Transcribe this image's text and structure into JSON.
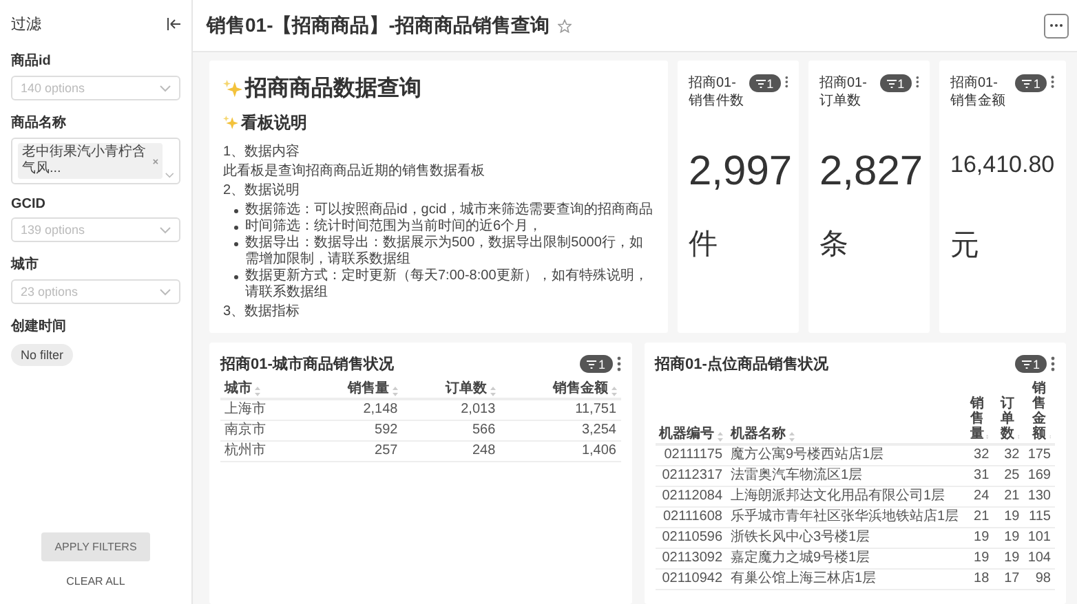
{
  "sidebar": {
    "title": "过滤",
    "filters": [
      {
        "kind": "select",
        "label": "商品id",
        "placeholder": "140 options"
      },
      {
        "kind": "multi",
        "label": "商品名称",
        "tags": [
          "老中街果汽小青柠含气风..."
        ]
      },
      {
        "kind": "select",
        "label": "GCID",
        "placeholder": "139 options"
      },
      {
        "kind": "select",
        "label": "城市",
        "placeholder": "23 options"
      },
      {
        "kind": "chip",
        "label": "创建时间",
        "value": "No filter"
      }
    ],
    "apply_button": "APPLY FILTERS",
    "clear_button": "CLEAR ALL"
  },
  "header": {
    "title": "销售01-【招商商品】-招商商品销售查询",
    "starred": false
  },
  "markdown": {
    "heading": "招商商品数据查询",
    "subheading": "看板说明",
    "blocks": [
      {
        "kind": "para",
        "text": "1、数据内容"
      },
      {
        "kind": "para",
        "text": "此看板是查询招商商品近期的销售数据看板"
      },
      {
        "kind": "para",
        "text": "2、数据说明"
      },
      {
        "kind": "list",
        "items": [
          "数据筛选：可以按照商品id，gcid，城市来筛选需要查询的招商商品",
          "时间筛选：统计时间范围为当前时间的近6个月，",
          "数据导出：数据导出：数据展示为500，数据导出限制5000行，如需增加限制，请联系数据组",
          "数据更新方式：定时更新（每天7:00-8:00更新），如有特殊说明，请联系数据组"
        ]
      },
      {
        "kind": "para",
        "text": "3、数据指标"
      }
    ]
  },
  "kpis": [
    {
      "title": "招商01-销售件数",
      "filter_count": "1",
      "value": "2,997",
      "unit": "件"
    },
    {
      "title": "招商01-订单数",
      "filter_count": "1",
      "value": "2,827",
      "unit": "条"
    },
    {
      "title": "招商01-销售金额",
      "filter_count": "1",
      "value": "16,410.80",
      "unit": "元"
    }
  ],
  "tables": [
    {
      "title": "招商01-城市商品销售状况",
      "filter_count": "1",
      "columns": [
        "城市",
        "销售量",
        "订单数",
        "销售金额"
      ],
      "rows": [
        [
          "上海市",
          "2,148",
          "2,013",
          "11,751"
        ],
        [
          "南京市",
          "592",
          "566",
          "3,254"
        ],
        [
          "杭州市",
          "257",
          "248",
          "1,406"
        ]
      ]
    },
    {
      "title": "招商01-点位商品销售状况",
      "filter_count": "1",
      "columns": [
        "机器编号",
        "机器名称",
        "销售量",
        "订单数",
        "销售金额"
      ],
      "rows": [
        [
          "02111175",
          "魔方公寓9号楼西站店1层",
          "32",
          "32",
          "175"
        ],
        [
          "02112317",
          "法雷奥汽车物流区1层",
          "31",
          "25",
          "169"
        ],
        [
          "02112084",
          "上海朗派邦达文化用品有限公司1层",
          "24",
          "21",
          "130"
        ],
        [
          "02111608",
          "乐乎城市青年社区张华浜地铁站店1层",
          "21",
          "19",
          "115"
        ],
        [
          "02110596",
          "浙铁长风中心3号楼1层",
          "19",
          "19",
          "101"
        ],
        [
          "02113092",
          "嘉定魔力之城9号楼1层",
          "19",
          "19",
          "104"
        ],
        [
          "02110942",
          "有巢公馆上海三林店1层",
          "18",
          "17",
          "98"
        ]
      ]
    }
  ]
}
